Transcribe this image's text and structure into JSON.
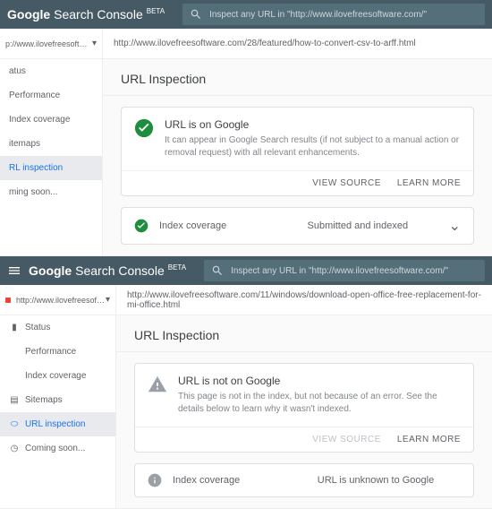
{
  "top": {
    "logo_bold": "Google",
    "logo_rest": " Search Console",
    "beta": "BETA",
    "search_placeholder": "Inspect any URL in \"http://www.ilovefreesoftware.com/\"",
    "property": "p://www.ilovefreesoftwa...",
    "url": "http://www.ilovefreesoftware.com/28/featured/how-to-convert-csv-to-arff.html",
    "section": "URL Inspection",
    "status_title": "URL is on Google",
    "status_desc": "It can appear in Google Search results (if not subject to a manual action or removal request) with all relevant enhancements.",
    "action_view": "VIEW SOURCE",
    "action_learn": "LEARN MORE",
    "coverage_label": "Index coverage",
    "coverage_value": "Submitted and indexed",
    "sidebar": [
      "atus",
      "Performance",
      "Index coverage",
      "itemaps",
      "RL inspection",
      "ming soon..."
    ]
  },
  "bottom": {
    "logo_bold": "Google",
    "logo_rest": " Search Console",
    "beta": "BETA",
    "search_placeholder": "Inspect any URL in \"http://www.ilovefreesoftware.com/\"",
    "property": "http://www.ilovefreesoftwa...",
    "url": "http://www.ilovefreesoftware.com/11/windows/download-open-office-free-replacement-for-mi-office.html",
    "section": "URL Inspection",
    "status_title": "URL is not on Google",
    "status_desc": "This page is not in the index, but not because of an error. See the details below to learn why it wasn't indexed.",
    "action_view": "VIEW SOURCE",
    "action_learn": "LEARN MORE",
    "coverage_label": "Index coverage",
    "coverage_value": "URL is unknown to Google",
    "sidebar": [
      "Status",
      "Performance",
      "Index coverage",
      "Sitemaps",
      "URL inspection",
      "Coming soon..."
    ]
  }
}
